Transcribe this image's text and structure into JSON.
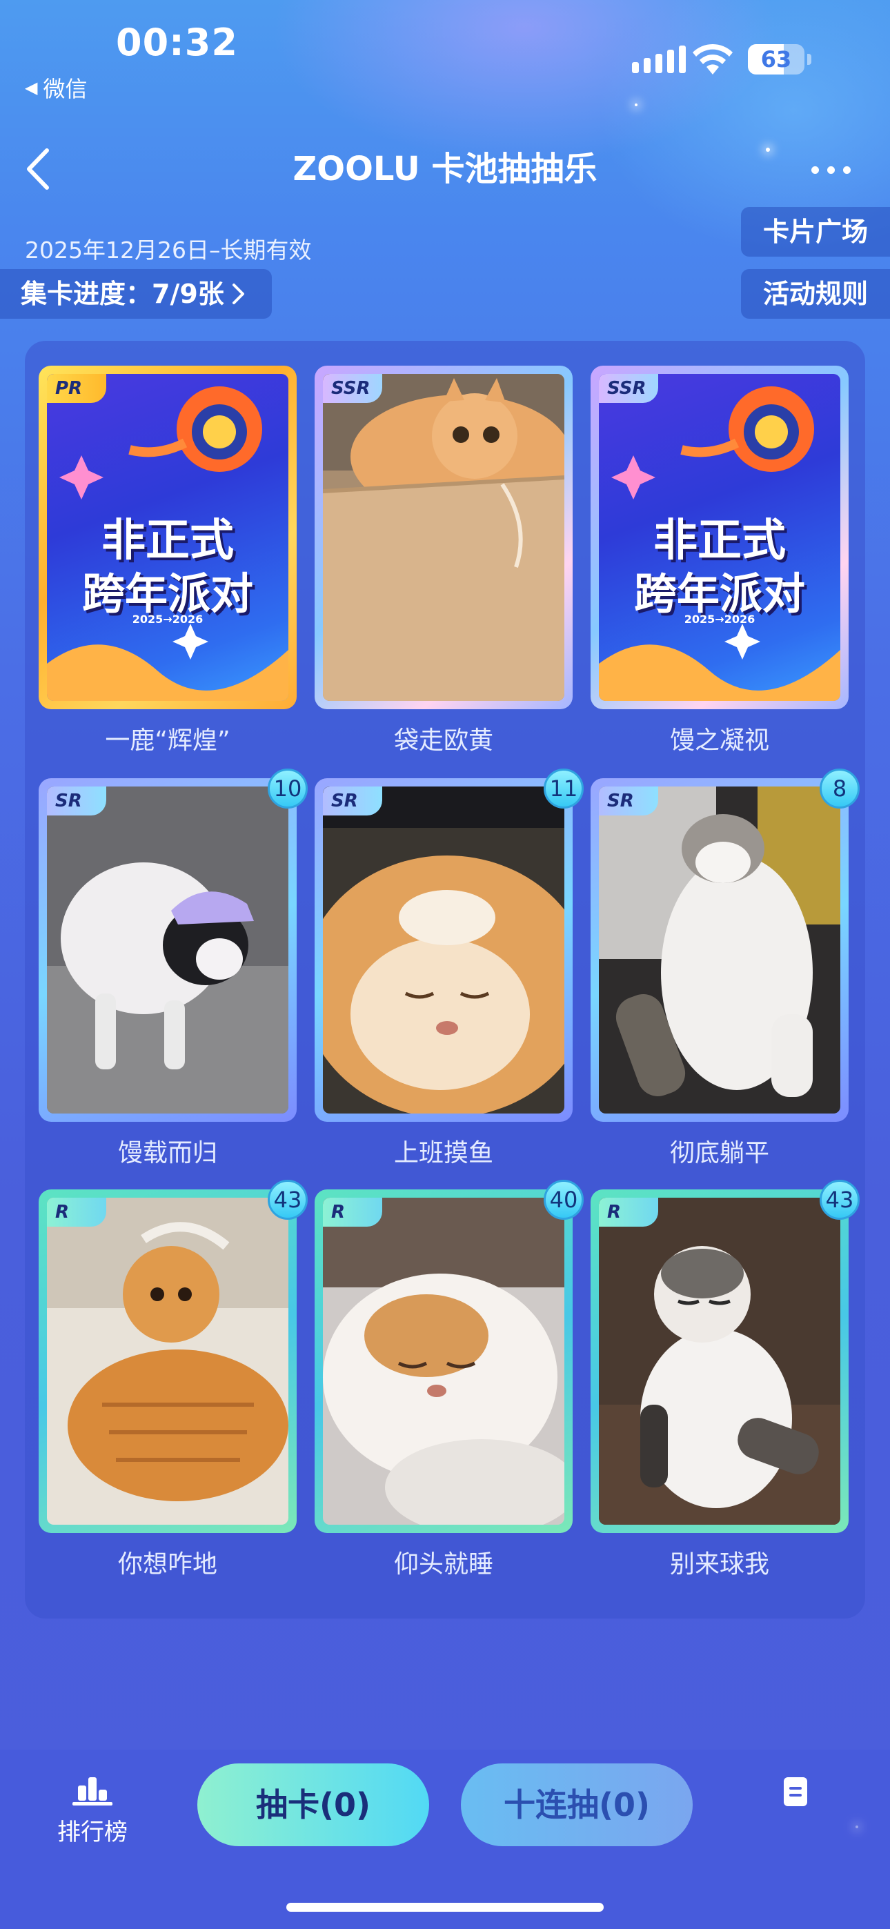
{
  "status_bar": {
    "time": "00:32",
    "back_app": "微信",
    "battery": "63"
  },
  "nav": {
    "title": "ZOOLU 卡池抽抽乐"
  },
  "info": {
    "date_range": "2025年12月26日–长期有效",
    "progress_label": "集卡进度：7/9张",
    "card_square": "卡片广场",
    "rules": "活动规则"
  },
  "cards": [
    {
      "name": "一鹿“辉煌”",
      "rarity": "PR",
      "count": "",
      "art": "party-poster"
    },
    {
      "name": "袋走欧黄",
      "rarity": "SSR",
      "count": "",
      "art": "cat-in-paper-bag"
    },
    {
      "name": "馒之凝视",
      "rarity": "SSR",
      "count": "",
      "art": "party-poster"
    },
    {
      "name": "馒载而归",
      "rarity": "SR",
      "count": "10",
      "art": "dog-with-cap"
    },
    {
      "name": "上班摸鱼",
      "rarity": "SR",
      "count": "11",
      "art": "sleeping-orange-cat"
    },
    {
      "name": "彻底躺平",
      "rarity": "SR",
      "count": "8",
      "art": "cat-lying-belly-up"
    },
    {
      "name": "你想咋地",
      "rarity": "R",
      "count": "43",
      "art": "orange-tabby-on-sofa"
    },
    {
      "name": "仰头就睡",
      "rarity": "R",
      "count": "40",
      "art": "cat-sleeping-head-up"
    },
    {
      "name": "别来球我",
      "rarity": "R",
      "count": "43",
      "art": "cat-sitting-grumpy"
    }
  ],
  "poster_text": {
    "line1": "非正式",
    "line2": "跨年派对",
    "year": "2025→2026"
  },
  "bottom": {
    "rank_label": "排行榜",
    "draw_label": "抽卡(0)",
    "draw10_label": "十连抽(0)"
  },
  "colors": {
    "accent_mint": "#8ff0d0",
    "accent_cyan": "#52d9f5",
    "background": "#4b5ddc"
  }
}
